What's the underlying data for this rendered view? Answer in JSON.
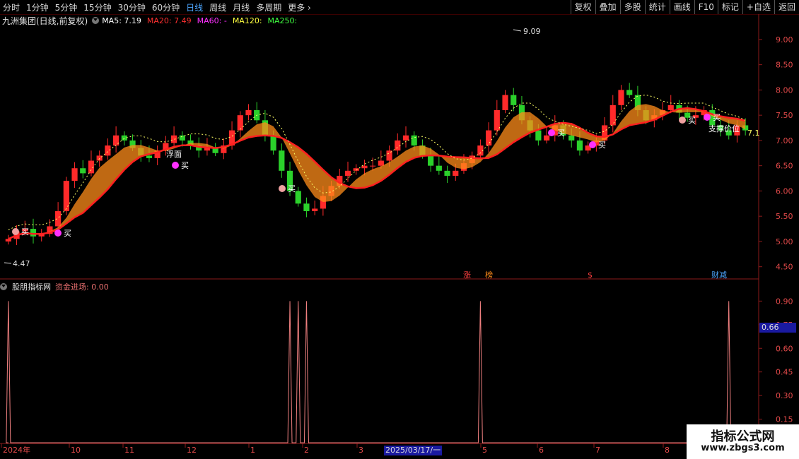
{
  "toolbar": {
    "periods": [
      "分时",
      "1分钟",
      "5分钟",
      "15分钟",
      "30分钟",
      "60分钟",
      "日线",
      "周线",
      "月线",
      "多周期",
      "更多"
    ],
    "active_period": "日线",
    "more_arrow": "›",
    "right_buttons": [
      "复权",
      "叠加",
      "多股",
      "统计",
      "画线",
      "F10",
      "标记",
      "+自选",
      "返回"
    ]
  },
  "legend": {
    "name": "九洲集团(日线,前复权)",
    "ma5": "MA5: 7.19",
    "ma20": "MA20: 7.49",
    "ma60": "MA60: -",
    "ma120": "MA120:",
    "ma250": "MA250:",
    "colors": {
      "ma5": "#ffffff",
      "ma20": "#ff3030",
      "ma60": "#ff30ff",
      "ma120": "#ffff40",
      "ma250": "#40ff40"
    }
  },
  "price_axis": [
    "9.00",
    "8.50",
    "8.00",
    "7.50",
    "7.00",
    "6.50",
    "6.00",
    "5.50",
    "5.00",
    "4.50"
  ],
  "price_marks": {
    "high": "9.09",
    "low": "4.47",
    "last": "7.1"
  },
  "annotations": {
    "buy": "买",
    "float_label": "浮面",
    "support_label": "支撑价位",
    "tags": [
      "涨",
      "榜",
      "$",
      "财减"
    ]
  },
  "indicator": {
    "name": "股朋指标网",
    "value_label": "资金进场: 0.00",
    "axis": [
      "0.90",
      "0.75",
      "0.60",
      "0.45",
      "0.30",
      "0.15"
    ],
    "cursor_value": "0.66"
  },
  "dates": [
    "2024年",
    "10",
    "11",
    "12",
    "1",
    "2",
    "3",
    "4",
    "5",
    "6",
    "7",
    "8"
  ],
  "cursor_date": "2025/03/17/一",
  "watermark": {
    "title": "指标公式网",
    "url": "www.zbgs3.com"
  },
  "chart_data": {
    "type": "candlestick",
    "price_range": [
      4.3,
      9.25
    ],
    "indicator_range": [
      0,
      0.96
    ],
    "closes": [
      5.05,
      5.2,
      5.25,
      5.1,
      5.15,
      5.3,
      5.6,
      6.2,
      6.45,
      6.35,
      6.6,
      6.7,
      6.9,
      7.1,
      7.0,
      6.85,
      6.7,
      6.65,
      6.8,
      6.95,
      7.1,
      7.0,
      6.9,
      6.8,
      6.85,
      6.75,
      6.9,
      7.2,
      7.5,
      7.6,
      7.4,
      7.1,
      6.8,
      6.4,
      6.0,
      5.75,
      5.6,
      5.65,
      5.9,
      6.1,
      6.3,
      6.4,
      6.45,
      6.5,
      6.5,
      6.6,
      6.8,
      7.0,
      7.1,
      6.9,
      6.7,
      6.5,
      6.4,
      6.3,
      6.4,
      6.55,
      6.7,
      6.9,
      7.2,
      7.6,
      7.9,
      7.7,
      7.4,
      7.2,
      7.0,
      7.1,
      7.3,
      7.1,
      7.0,
      6.8,
      6.9,
      7.0,
      7.3,
      7.7,
      8.0,
      7.9,
      7.6,
      7.4,
      7.5,
      7.6,
      7.7,
      7.55,
      7.45,
      7.5,
      7.6,
      7.3,
      7.2,
      7.1,
      7.3,
      7.2
    ],
    "signals": [
      0.9,
      0,
      0,
      0,
      0,
      0,
      0,
      0,
      0,
      0,
      0,
      0,
      0,
      0,
      0,
      0,
      0,
      0,
      0,
      0,
      0,
      0,
      0,
      0,
      0,
      0,
      0,
      0,
      0,
      0,
      0,
      0,
      0,
      0,
      0.9,
      0.9,
      0.9,
      0,
      0,
      0,
      0,
      0,
      0,
      0,
      0,
      0,
      0,
      0,
      0,
      0,
      0,
      0,
      0,
      0,
      0,
      0,
      0,
      0.9,
      0,
      0,
      0,
      0,
      0,
      0,
      0,
      0,
      0,
      0,
      0,
      0,
      0,
      0,
      0,
      0,
      0,
      0,
      0,
      0,
      0,
      0,
      0,
      0,
      0,
      0,
      0,
      0,
      0,
      0.9,
      0,
      0
    ]
  }
}
